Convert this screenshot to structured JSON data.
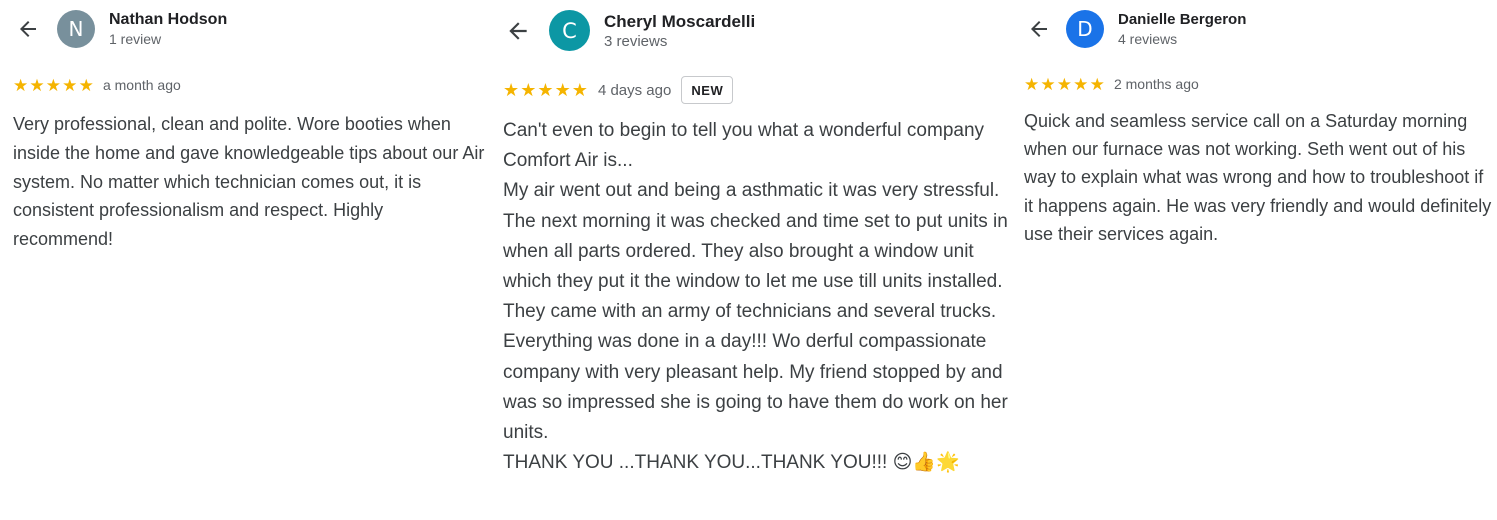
{
  "reviews": [
    {
      "avatar_letter": "N",
      "avatar_color": "#78909c",
      "name": "Nathan Hodson",
      "review_count": "1 review",
      "stars": "★★★★★",
      "rating": 5,
      "date": "a month ago",
      "text": "Very professional, clean and polite. Wore booties when inside the home and gave knowledgeable tips about our Air system. No matter which technician comes out, it is consistent professionalism and respect. Highly recommend!"
    },
    {
      "avatar_letter": "C",
      "avatar_color": "#0c97a4",
      "name": "Cheryl Moscardelli",
      "review_count": "3 reviews",
      "stars": "★★★★★",
      "rating": 5,
      "date": "4 days ago",
      "badge": "NEW",
      "text": "Can't even to begin to tell you what a wonderful company Comfort Air is...\nMy air went out and being a asthmatic it was very stressful. The next morning it was checked and time set to put units in when all parts ordered. They also brought a window unit which they put it the window to let me use till units installed. They came with an army of technicians and several trucks. Everything was done in a day!!! Wo derful compassionate company with very pleasant help. My friend stopped by and was so impressed she is going to have them do work on her units.\nTHANK YOU ...THANK YOU...THANK YOU!!! 😊👍🌟"
    },
    {
      "avatar_letter": "D",
      "avatar_color": "#1a73e8",
      "name": "Danielle Bergeron",
      "review_count": "4 reviews",
      "stars": "★★★★★",
      "rating": 5,
      "date": "2 months ago",
      "text": "Quick and seamless service call on a Saturday morning when our furnace was not working. Seth went out of his way to explain what was wrong and how to troubleshoot if it happens again. He was very friendly and would definitely use their services again."
    }
  ],
  "icons": {
    "back": "back-arrow-icon",
    "star": "star-icon"
  },
  "colors": {
    "star": "#f5b400",
    "secondary_text": "#5f6368"
  }
}
